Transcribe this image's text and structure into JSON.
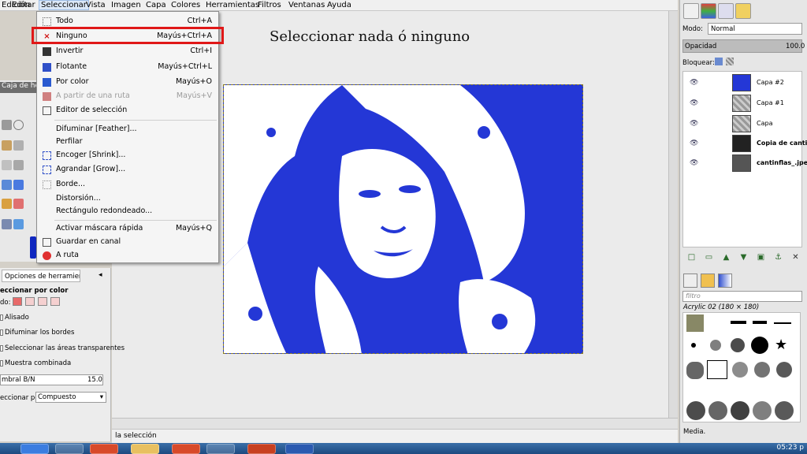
{
  "menubar": {
    "items": [
      "Edición",
      "Editar",
      "Vista",
      "Imagen",
      "Capa",
      "Colores",
      "Herramientas",
      "Filtros",
      "Ventanas",
      "Ayuda"
    ],
    "active": "Seleccionar"
  },
  "heading": "Seleccionar nada ó ninguno",
  "dropdown": {
    "todo": {
      "label": "Todo",
      "shortcut": "Ctrl+A"
    },
    "ninguno": {
      "label": "Ninguno",
      "shortcut": "Mayús+Ctrl+A"
    },
    "invertir": {
      "label": "Invertir",
      "shortcut": "Ctrl+I"
    },
    "flotante": {
      "label": "Flotante",
      "shortcut": "Mayús+Ctrl+L"
    },
    "por_color": {
      "label": "Por color",
      "shortcut": "Mayús+O"
    },
    "a_partir_ruta": {
      "label": "A partir de una ruta",
      "shortcut": "Mayús+V"
    },
    "editor_seleccion": {
      "label": "Editor de selección"
    },
    "difuminar": {
      "label": "Difuminar [Feather]..."
    },
    "perfilar": {
      "label": "Perfilar"
    },
    "encoger": {
      "label": "Encoger [Shrink]..."
    },
    "agrandar": {
      "label": "Agrandar [Grow]..."
    },
    "borde": {
      "label": "Borde..."
    },
    "distorsion": {
      "label": "Distorsión..."
    },
    "rectangulo": {
      "label": "Rectángulo redondeado..."
    },
    "mascara": {
      "label": "Activar máscara rápida",
      "shortcut": "Mayús+Q"
    },
    "guardar_canal": {
      "label": "Guardar en canal"
    },
    "a_ruta": {
      "label": "A ruta"
    }
  },
  "toolbox_title": "Caja de herra",
  "tool_options": {
    "tab": "Opciones de herramienta",
    "title": "eccionar por color",
    "mode_label": "do:",
    "alisado": "Alisado",
    "difuminar_bordes": "Difuminar los bordes",
    "areas_transparentes": "Seleccionar las áreas transparentes",
    "muestra_combinada": "Muestra combinada",
    "threshold_label": "mbral B/N",
    "threshold_value": "15.0",
    "select_by_label": "eccionar por:",
    "select_by_value": "Compuesto"
  },
  "status": "la selección",
  "right_dock": {
    "mode_label": "Modo:",
    "mode_value": "Normal",
    "opacity_label": "Opacidad",
    "opacity_value": "100.0",
    "opacity_fraction": 1.0,
    "lock_label": "Bloquear:",
    "layers": [
      "Capa #2",
      "Capa #1",
      "Capa",
      "Copia de cantinfla",
      "cantinflas_.jpeg"
    ],
    "brush_filter": "filtro",
    "brush_name": "Acrylic 02 (180 × 180)",
    "bottom_label": "Media."
  },
  "taskbar": {
    "clock": "05:23 p"
  },
  "colors": {
    "image_blue": "#2437d6",
    "highlight_red": "#e01818"
  }
}
